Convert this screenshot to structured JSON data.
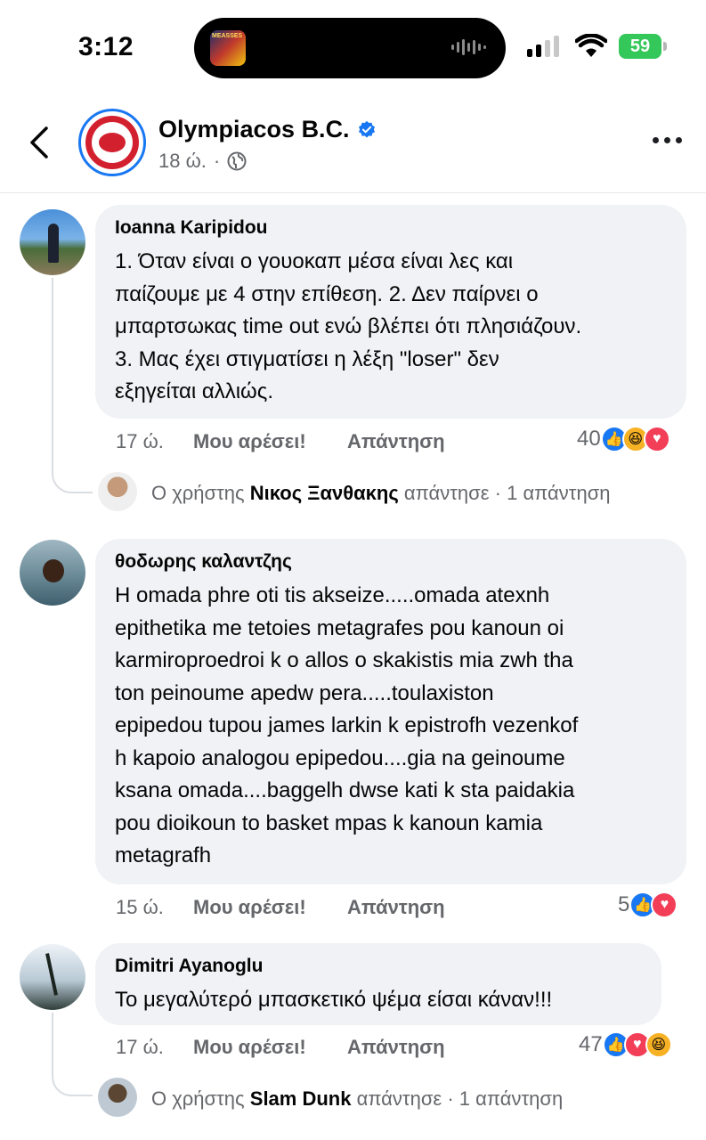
{
  "status": {
    "time": "3:12",
    "battery": "59",
    "island_art_text": "MEASSES"
  },
  "header": {
    "page_name": "Olympiacos B.C.",
    "time_ago": "18 ώ.",
    "separator": "·"
  },
  "labels": {
    "like": "Μου αρέσει!",
    "reply": "Απάντηση"
  },
  "comments": [
    {
      "author": "Ioanna Karipidou",
      "lines": [
        "1. Όταν είναι ο γουοκαπ μέσα είναι λες και",
        "παίζουμε με 4 στην επίθεση. 2. Δεν παίρνει ο",
        "μπαρτσωκας time out ενώ βλέπει ότι πλησιάζουν.",
        "3. Μας έχει στιγματίσει η λέξη \"loser\" δεν",
        "εξηγείται αλλιώς."
      ],
      "time": "17 ώ.",
      "reactions_count": "40",
      "reply_summary": {
        "prefix": "Ο χρήστης",
        "name": "Νικος Ξανθακης",
        "verb": "απάντησε",
        "sep": "·",
        "count": "1 απάντηση"
      }
    },
    {
      "author": "θοδωρης καλαντζης",
      "lines": [
        "H omada phre oti tis akseize.....omada atexnh",
        "epithetika me tetoies metagrafes pou kanoun oi",
        "karmiroproedroi k o allos o skakistis mia zwh tha",
        "ton peinoume apedw pera.....toulaxiston",
        "epipedou tupou james larkin k epistrofh vezenkof",
        "h kapoio analogou epipedou....gia na geinoume",
        "ksana omada....baggelh dwse kati k sta paidakia",
        "pou dioikoun to basket mpas k kanoun kamia",
        "metagrafh"
      ],
      "time": "15 ώ.",
      "reactions_count": "5"
    },
    {
      "author": "Dimitri Ayanoglu",
      "lines": [
        "Το μεγαλύτερό μπασκετικό ψέμα είσαι κάναν!!!"
      ],
      "time": "17 ώ.",
      "reactions_count": "47",
      "reply_summary": {
        "prefix": "Ο χρήστης",
        "name": "Slam Dunk",
        "verb": "απάντησε",
        "sep": "·",
        "count": "1 απάντηση"
      }
    }
  ],
  "reaction_icons": {
    "like": "thumbs-up-icon",
    "haha": "laughing-face-icon",
    "love": "heart-icon"
  },
  "colors": {
    "accent": "#1877f2",
    "bubble": "#f0f2f5",
    "muted": "#65676b",
    "battery": "#34c759"
  }
}
